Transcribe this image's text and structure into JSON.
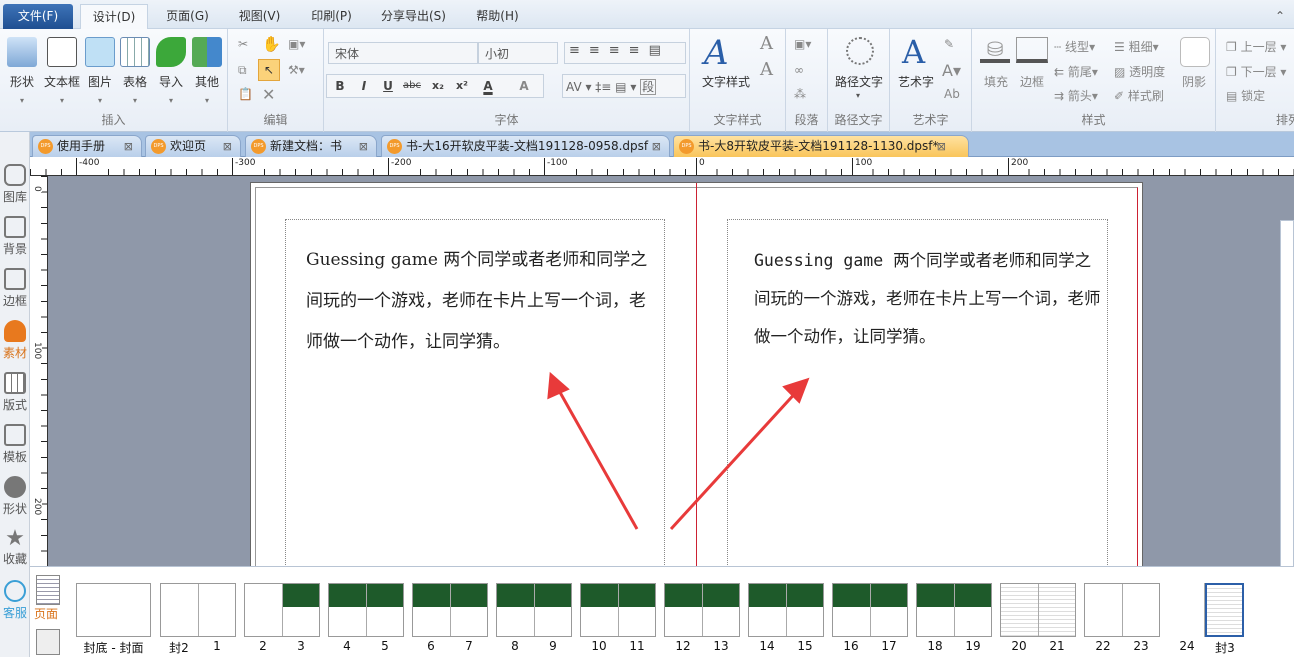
{
  "menu": {
    "tabs": [
      "文件(F)",
      "设计(D)",
      "页面(G)",
      "视图(V)",
      "印刷(P)",
      "分享导出(S)",
      "帮助(H)"
    ]
  },
  "ribbon": {
    "insert": {
      "label": "插入",
      "items": [
        "形状",
        "文本框",
        "图片",
        "表格",
        "导入",
        "其他"
      ]
    },
    "edit": {
      "label": "编辑"
    },
    "font": {
      "label": "字体",
      "font_name": "宋体",
      "font_size": "小初",
      "buttons": [
        "B",
        "I",
        "U",
        "abc",
        "x₂",
        "x²",
        "A",
        "A"
      ],
      "para_button": "段"
    },
    "text_style": {
      "label": "文字样式",
      "button": "文字样式"
    },
    "paragraph": {
      "label": "段落"
    },
    "path_text": {
      "label": "路径文字",
      "button": "路径文字"
    },
    "art_text": {
      "label": "艺术字",
      "button": "艺术字"
    },
    "style": {
      "label": "样式",
      "fill": "填充",
      "border": "边框",
      "line_type": "线型",
      "weight": "粗细",
      "arrow_tail": "箭尾",
      "transparency": "透明度",
      "arrow_head": "箭头",
      "format_brush": "样式刷",
      "shadow": "阴影"
    },
    "arrange": {
      "label": "排列",
      "up": "上一层",
      "down": "下一层",
      "lock": "锁定"
    }
  },
  "doc_tabs": [
    "使用手册",
    "欢迎页",
    "新建文档：书",
    "书-大16开软皮平装-文档191128-0958.dpsf",
    "书-大8开软皮平装-文档191128-1130.dpsf*"
  ],
  "left_sidebar": [
    "图库",
    "背景",
    "边框",
    "素材",
    "版式",
    "模板",
    "形状",
    "收藏",
    "客服"
  ],
  "ruler": {
    "top": [
      "-400",
      "-300",
      "-200",
      "-100",
      "0",
      "100",
      "200"
    ],
    "left": [
      "0",
      "100",
      "200"
    ]
  },
  "page": {
    "left_text": "Guessing game  两个同学或者老师和同学之间玩的一个游戏，老师在卡片上写一个词，老师做一个动作，让同学猜。",
    "right_text": "Guessing game  两个同学或者老师和同学之间玩的一个游戏，老师在卡片上写一个词，老师做一个动作，让同学猜。"
  },
  "thumbnails": {
    "panel_tab": "页面",
    "labels": [
      "封底 - 封面",
      "封2",
      "1",
      "2",
      "3",
      "4",
      "5",
      "6",
      "7",
      "8",
      "9",
      "10",
      "11",
      "12",
      "13",
      "14",
      "15",
      "16",
      "17",
      "18",
      "19",
      "20",
      "21",
      "22",
      "23",
      "24",
      "封3"
    ]
  },
  "colors": {
    "accent": "#f39a2c",
    "spine": "#cc2233",
    "arrow": "#e83a3a",
    "thumb_green": "#1e5a2a"
  }
}
